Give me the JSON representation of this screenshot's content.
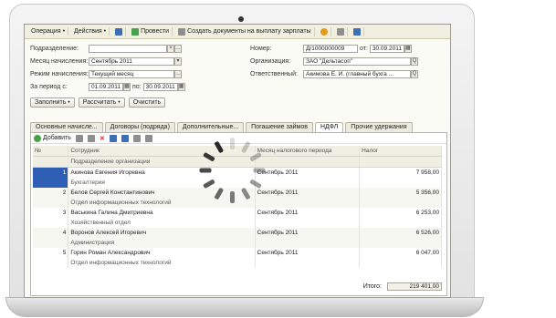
{
  "toolbar": {
    "operation": "Операция •",
    "actions": "Действия •",
    "post": "Провести",
    "create_docs": "Создать документы на выплату зарплаты"
  },
  "form": {
    "department_label": "Подразделение:",
    "department_value": "",
    "number_label": "Номер:",
    "number_value": "Д/1000000009",
    "from_label": "от:",
    "from_value": "30.09.2011",
    "accrual_month_label": "Месяц начисления:",
    "accrual_month_value": "Сентябрь 2011",
    "organization_label": "Организация:",
    "organization_value": "ЗАО \"Дельтасоп\"",
    "mode_label": "Режим начисления:",
    "mode_value": "Текущий месяц",
    "responsible_label": "Ответственный:",
    "responsible_value": "Акимова Е. И. (главный бухга ...",
    "period_label": "За период с:",
    "period_from": "01.09.2011",
    "period_to_label": "по:",
    "period_to": "30.09.2011"
  },
  "buttons": {
    "fill": "Заполнить •",
    "calculate": "Рассчитать •",
    "clear": "Очистить"
  },
  "tabs": [
    "Основные начисле...",
    "Договоры (подряда)",
    "Дополнительные...",
    "Погашение займов",
    "НДФЛ",
    "Прочие удержания"
  ],
  "active_tab": 4,
  "grid_toolbar": {
    "add": "Добавить"
  },
  "table": {
    "headers": [
      "№",
      "Сотрудник",
      "Месяц налогового периода",
      "Налог"
    ],
    "subheader": "Подразделение организации",
    "rows": [
      {
        "no": "1",
        "employee": "Акинова Евгения Игоревна",
        "dept": "Бухгалтерия",
        "month": "Сентябрь 2011",
        "tax": "7 958,00"
      },
      {
        "no": "2",
        "employee": "Белов Сергей Константинович",
        "dept": "Отдел информационных технологий",
        "month": "Сентябрь 2011",
        "tax": "5 356,00"
      },
      {
        "no": "3",
        "employee": "Васькина Галина Дмитриевна",
        "dept": "Хозяйственный отдел",
        "month": "Сентябрь 2011",
        "tax": "6 253,00"
      },
      {
        "no": "4",
        "employee": "Воронов Алексей Игоревич",
        "dept": "Администрация",
        "month": "Сентябрь 2011",
        "tax": "6 526,00"
      },
      {
        "no": "5",
        "employee": "Горин Роман Александрович",
        "dept": "Отдел информационных технологий",
        "month": "Сентябрь 2011",
        "tax": "6 047,00"
      }
    ]
  },
  "total": {
    "label": "Итого:",
    "value": "219 401,00"
  },
  "colors": {
    "selection": "#2f5fb5",
    "spinner": "#1a1a1a"
  }
}
